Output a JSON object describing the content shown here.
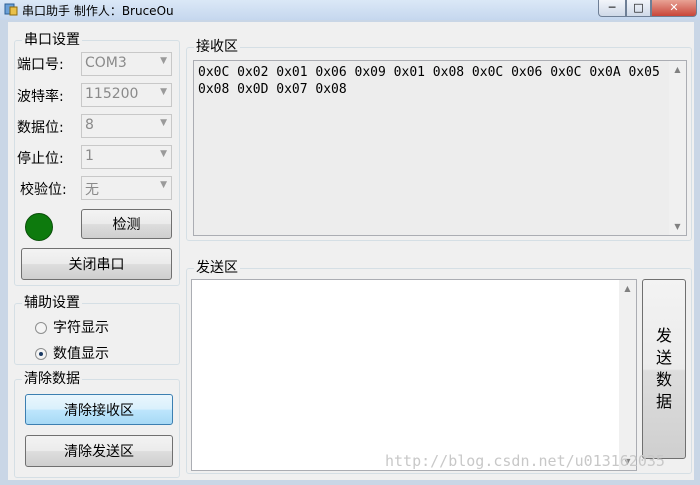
{
  "window": {
    "title": "串口助手 制作人：BruceOu",
    "min_glyph": "─",
    "max_glyph": "□",
    "close_glyph": "✕"
  },
  "serial_settings": {
    "group_title": "串口设置",
    "port_label": "端口号:",
    "port_value": "COM3",
    "baud_label": "波特率:",
    "baud_value": "115200",
    "databits_label": "数据位:",
    "databits_value": "8",
    "stopbits_label": "停止位:",
    "stopbits_value": "1",
    "parity_label": "校验位:",
    "parity_value": "无",
    "detect_button": "检测",
    "close_port_button": "关闭串口",
    "status_led_color": "#0d7a0d"
  },
  "aux_settings": {
    "group_title": "辅助设置",
    "char_display": "字符显示",
    "value_display": "数值显示",
    "selected": "value_display"
  },
  "clear_data": {
    "group_title": "清除数据",
    "clear_receive_button": "清除接收区",
    "clear_send_button": "清除发送区"
  },
  "receive_area": {
    "group_title": "接收区",
    "content": "0x0C 0x02 0x01 0x06 0x09 0x01 0x08 0x0C 0x06 0x0C 0x0A 0x05 0x08 0x0D 0x07 0x08"
  },
  "send_area": {
    "group_title": "发送区",
    "content": "",
    "send_button": "发送数据",
    "send_button_chars": [
      "发",
      "送",
      "数",
      "据"
    ]
  },
  "icons": {
    "dropdown": "chevron-down-icon",
    "scroll_up": "scroll-up-icon",
    "scroll_down": "scroll-down-icon"
  },
  "watermark": "http://blog.csdn.net/u013162035"
}
